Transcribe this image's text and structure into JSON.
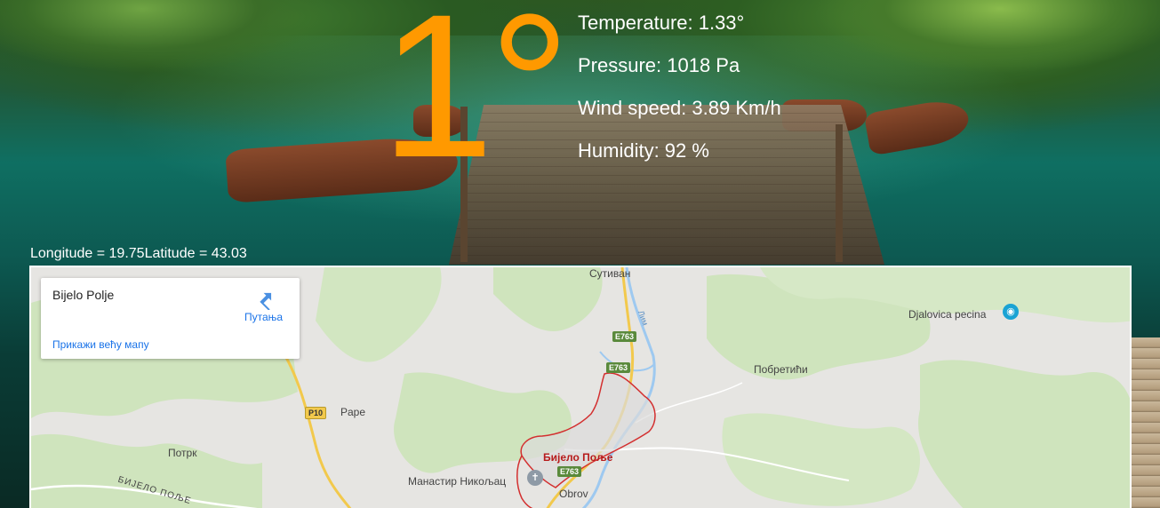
{
  "weather": {
    "big_temperature": "1°",
    "temperature": "Temperature: 1.33°",
    "pressure": "Pressure: 1018 Pa",
    "wind_speed": "Wind speed: 3.89 Km/h",
    "humidity": "Humidity: 92 %"
  },
  "coordinates": {
    "longitude": "Longitude = 19.75",
    "latitude": "Latitude = 43.03"
  },
  "map": {
    "info_card": {
      "place_name": "Bijelo Polje",
      "directions_label": "Путања",
      "larger_map_link": "Прикажи већу мапу"
    },
    "labels": {
      "sutivan": "Сутиван",
      "lim": "Лим",
      "djalovica": "Djalovica pecina",
      "pobretici": "Побретићи",
      "pape": "Pape",
      "potrk": "Потрк",
      "bijelo_polje_city": "Бијело Поље",
      "manastir": "Манастир Никољац",
      "obrov": "Obrov",
      "bijelo_road": "БИЈЕЛО ПОЉЕ"
    },
    "shields": {
      "e763_a": "E763",
      "e763_b": "E763",
      "e763_c": "E763",
      "p10": "P10"
    }
  },
  "colors": {
    "temperature_accent": "#ff9900",
    "city_boundary": "#d32f2f",
    "link_blue": "#1a73e8",
    "forest_green": "#c8e2b5",
    "map_base": "#e6e5e2"
  },
  "icons": {
    "directions": "directions-arrow-icon",
    "poi_cave": "camera-poi-icon",
    "poi_monastery": "church-poi-icon"
  }
}
